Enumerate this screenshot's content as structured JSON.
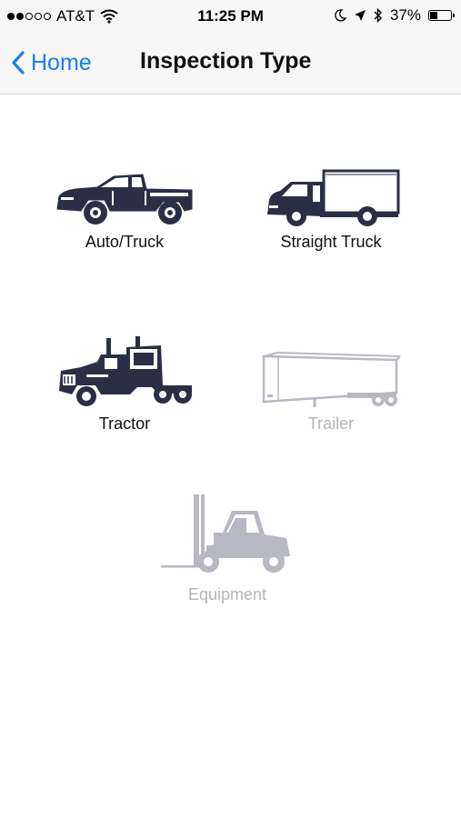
{
  "status_bar": {
    "carrier": "AT&T",
    "signal_bars_filled": 2,
    "signal_bars_total": 5,
    "time": "11:25 PM",
    "battery_percent": "37%",
    "battery_level": 0.37
  },
  "nav": {
    "back_label": "Home",
    "title": "Inspection Type"
  },
  "options": [
    {
      "label": "Auto/Truck",
      "icon": "pickup-truck-icon",
      "enabled": true
    },
    {
      "label": "Straight Truck",
      "icon": "box-truck-icon",
      "enabled": true
    },
    {
      "label": "Tractor",
      "icon": "semi-tractor-icon",
      "enabled": true
    },
    {
      "label": "Trailer",
      "icon": "trailer-icon",
      "enabled": false
    },
    {
      "label": "Equipment",
      "icon": "forklift-icon",
      "enabled": false
    }
  ],
  "colors": {
    "accent": "#1a7cf5",
    "icon_enabled": "#2b2f45",
    "icon_disabled": "#b8b8c4",
    "label_disabled": "#b5b5b5"
  }
}
